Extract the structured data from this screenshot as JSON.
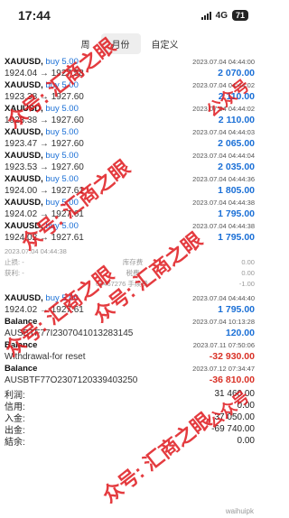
{
  "status": {
    "time": "17:44",
    "network": "4G",
    "battery": "71"
  },
  "tabs": [
    {
      "label": "周"
    },
    {
      "label": "月份"
    },
    {
      "label": "自定义"
    }
  ],
  "deals": [
    {
      "symbol": "XAUUSD,",
      "side": "buy 5.00",
      "time": "2023.07.04 04:44:00",
      "prices": "1924.04 → 1927.58",
      "profit": "2 070.00"
    },
    {
      "symbol": "XAUUSD,",
      "side": "buy 5.00",
      "time": "2023.07.04 04:44:02",
      "prices": "1923.38 → 1927.60",
      "profit": "2 110.00"
    },
    {
      "symbol": "XAUUSD,",
      "side": "buy 5.00",
      "time": "2023.07.04 04:44:02",
      "prices": "1923.38 → 1927.60",
      "profit": "2 110.00"
    },
    {
      "symbol": "XAUUSD,",
      "side": "buy 5.00",
      "time": "2023.07.04 04:44:03",
      "prices": "1923.47 → 1927.60",
      "profit": "2 065.00"
    },
    {
      "symbol": "XAUUSD,",
      "side": "buy 5.00",
      "time": "2023.07.04 04:44:04",
      "prices": "1923.53 → 1927.60",
      "profit": "2 035.00"
    },
    {
      "symbol": "XAUUSD,",
      "side": "buy 5.00",
      "time": "2023.07.04 04:44:36",
      "prices": "1924.00 → 1927.61",
      "profit": "1 805.00"
    },
    {
      "symbol": "XAUUSD,",
      "side": "buy 5.00",
      "time": "2023.07.04 04:44:38",
      "prices": "1924.02 → 1927.61",
      "profit": "1 795.00"
    },
    {
      "symbol": "XAUUSD,",
      "side": "buy 5.00",
      "time": "2023.07.04 04:44:38",
      "prices": "1924.02 → 1927.61",
      "profit": "1 795.00"
    }
  ],
  "detail": {
    "time": "2023.07.04 04:44:38",
    "sl_label": "止损:",
    "sl_value": "-",
    "swap_label": "库存费",
    "swap_value": "0.00",
    "tp_label": "获利:",
    "tp_value": "-",
    "tax_label": "税费",
    "tax_value": "0.00",
    "id": "69467276",
    "commission_label": "手续费",
    "commission_value": "-1.00"
  },
  "deal_last": {
    "symbol": "XAUUSD,",
    "side": "buy 5.00",
    "time": "2023.07.04 04:44:40",
    "prices": "1924.02 → 1927.61",
    "profit": "1 795.00"
  },
  "balances": [
    {
      "title": "Balance",
      "time": "2023.07.04 10:13:28",
      "comment": "AUSBTF77I2307041013283145",
      "amount": "120.00",
      "negative": false
    },
    {
      "title": "Balance",
      "time": "2023.07.11 07:50:06",
      "comment": "Withdrawal-for reset",
      "amount": "-32 930.00",
      "negative": true
    },
    {
      "title": "Balance",
      "time": "2023.07.12 07:34:47",
      "comment": "AUSBTF77O2307120339403250",
      "amount": "-36 810.00",
      "negative": true
    }
  ],
  "summary": [
    {
      "label": "利润:",
      "value": "31 460.00"
    },
    {
      "label": "信用:",
      "value": "0.00"
    },
    {
      "label": "入金:",
      "value": "37 050.00"
    },
    {
      "label": "出金:",
      "value": "-69 740.00"
    },
    {
      "label": "結余:",
      "value": "0.00"
    }
  ],
  "watermarks": [
    {
      "text": "众号: 汇商之眼"
    },
    {
      "text": "众号: 汇商之眼"
    },
    {
      "text": "众号: 汇商之眼"
    },
    {
      "text": "众号: 汇商之眼"
    },
    {
      "text": "众号: 汇商之眼"
    },
    {
      "text": "公众号"
    },
    {
      "text": "公众号"
    }
  ],
  "footer": {
    "logo": "waihuipk"
  },
  "colors": {
    "accent": "#1a6fd6",
    "negative": "#d93025",
    "watermark": "#e0191e"
  }
}
